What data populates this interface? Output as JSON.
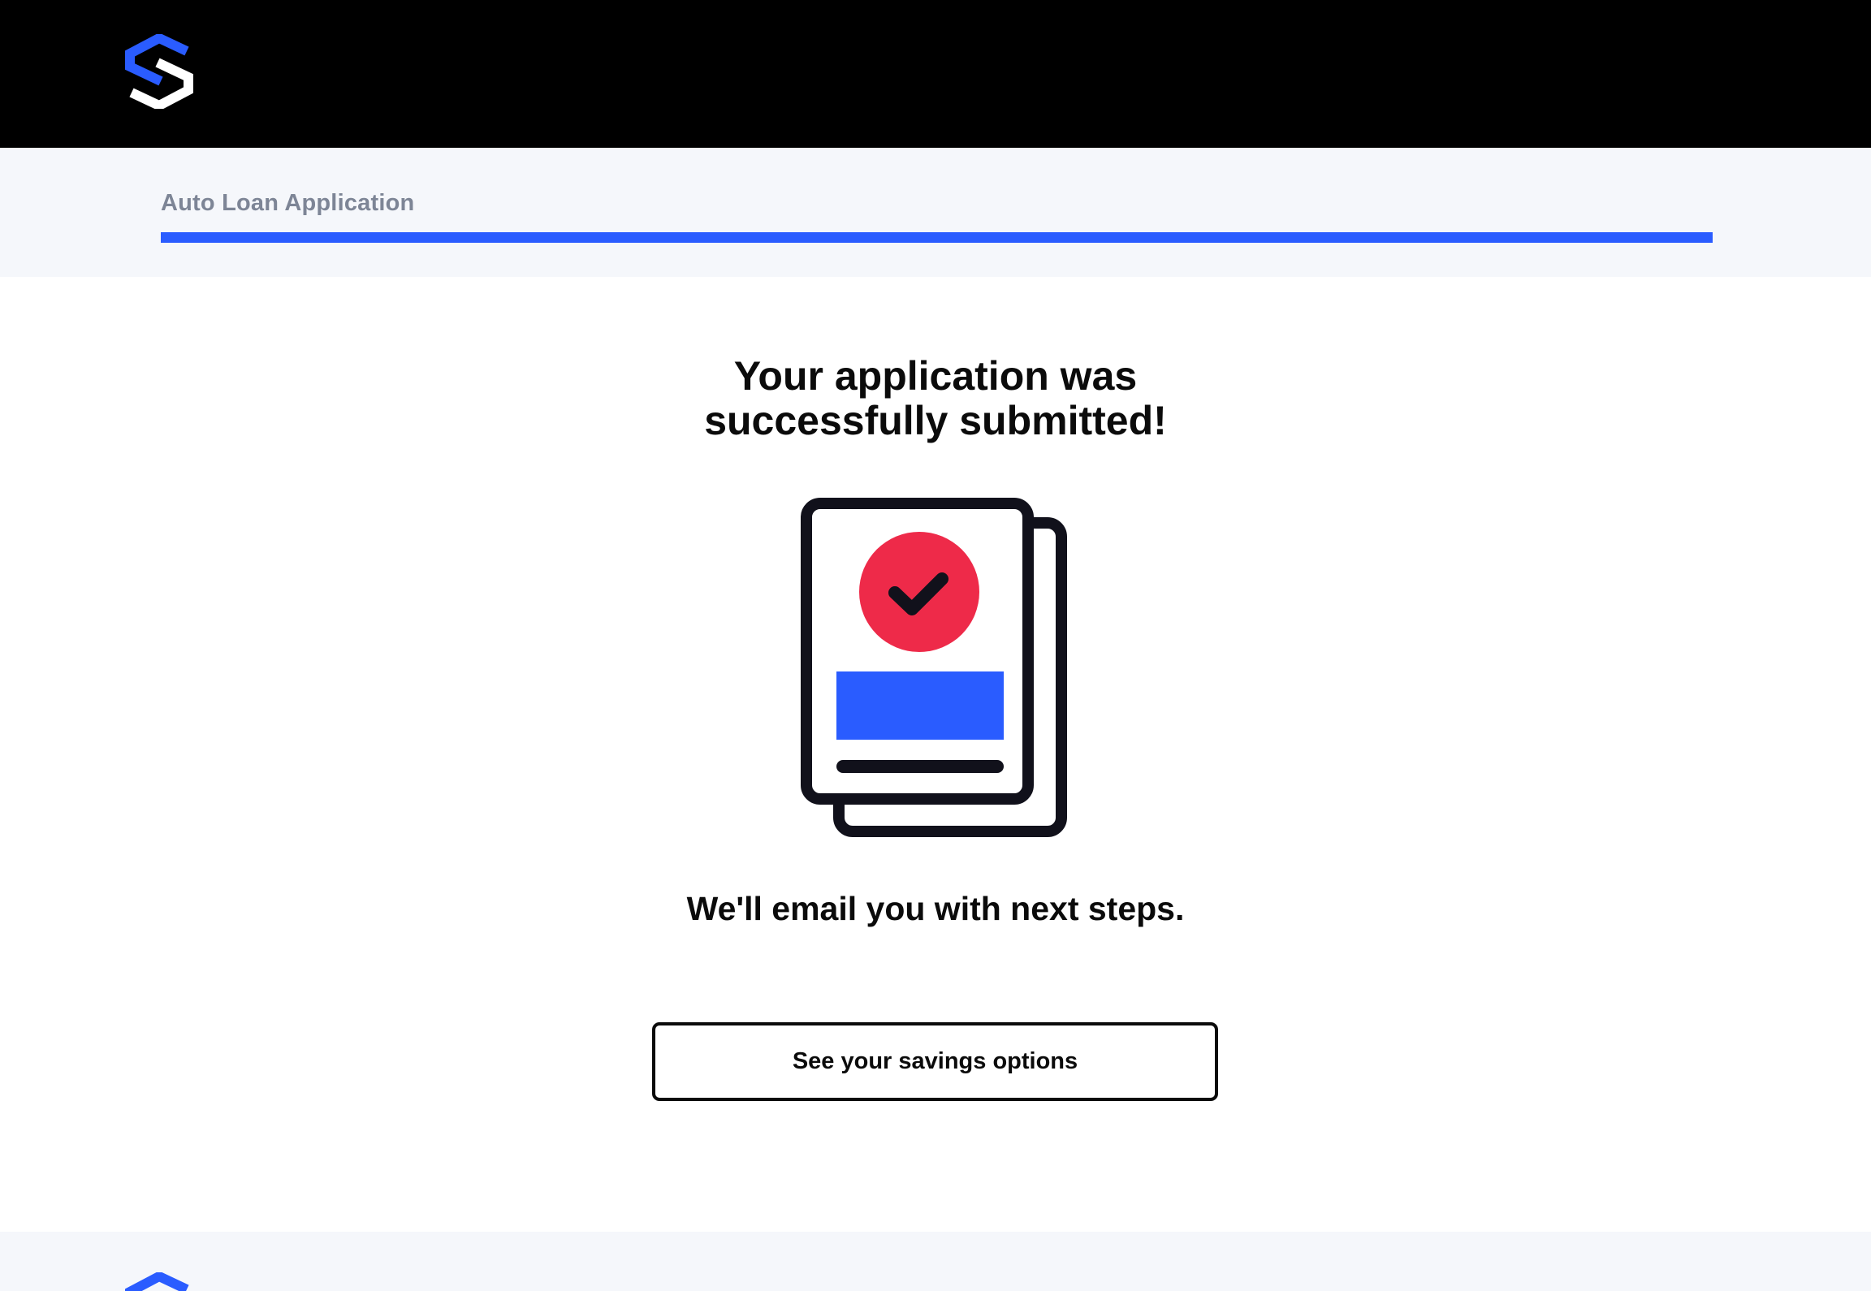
{
  "header": {
    "logo": "s-hexagon-logo"
  },
  "progress": {
    "title": "Auto Loan Application",
    "value": 1.0,
    "color": "#2a5cff"
  },
  "main": {
    "headline_line1": "Your application was",
    "headline_line2": "successfully submitted!",
    "illustration": "documents-checkmark-icon",
    "subtext": "We'll email you with next steps.",
    "button_label": "See your savings options"
  },
  "footer": {
    "logo": "s-hexagon-logo"
  },
  "colors": {
    "brand_blue": "#2a5cff",
    "check_red": "#ee2a49",
    "ink": "#11111b",
    "topbar": "#000000",
    "panel": "#f5f7fb",
    "muted_text": "#7d8596"
  }
}
